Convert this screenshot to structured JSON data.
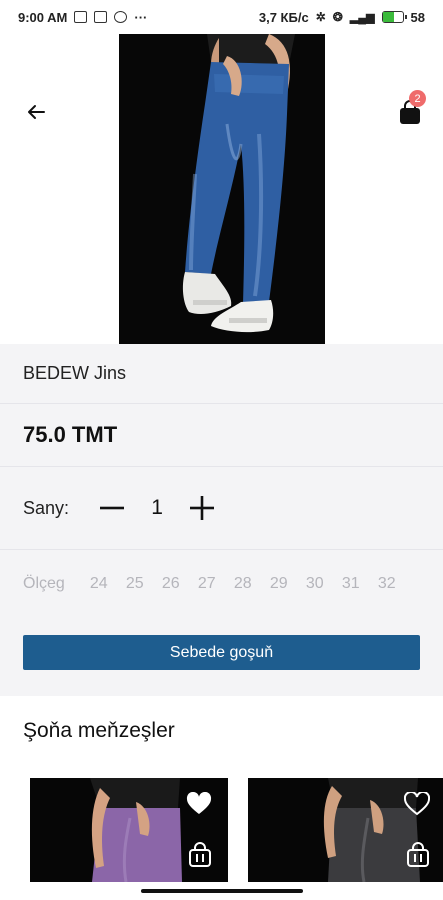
{
  "status_bar": {
    "time": "9:00 AM",
    "extra": "···",
    "speed": "3,7 КБ/c",
    "battery": "58"
  },
  "header": {
    "cart_count": "2"
  },
  "product": {
    "name": "BEDEW Jins",
    "price": "75.0 TMT",
    "quantity_label": "Sany:",
    "quantity": "1",
    "size_label": "Ölçeg",
    "sizes": [
      "24",
      "25",
      "26",
      "27",
      "28",
      "29",
      "30",
      "31",
      "32"
    ],
    "add_to_cart": "Sebede goşuň"
  },
  "similar": {
    "title": "Şoňa meňzeşler"
  },
  "colors": {
    "accent": "#1e5d8f",
    "badge": "#ef6b6b",
    "panel_bg": "#f4f4f6"
  }
}
